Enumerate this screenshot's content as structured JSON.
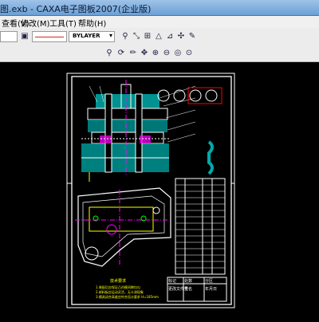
{
  "window": {
    "title": "图.exb - CAXA电子图板2007(企业版)"
  },
  "menu": {
    "items": [
      "查看(V)",
      "修改(M)",
      "工具(T)",
      "帮助(H)"
    ]
  },
  "toolbar": {
    "linetype_label": "BYLAYER"
  },
  "drawing": {
    "title_block": {
      "labels": [
        "标记",
        "处数",
        "分区",
        "更改文件号",
        "签名",
        "年月日"
      ]
    },
    "notes_title": "技术要求",
    "notes": [
      "1.装配后应保证凸凹模间隙均匀",
      "2.卸料板应运动灵活，无卡滞现象",
      "3.模具闭合高度应符合设计要求 H=185mm"
    ]
  }
}
